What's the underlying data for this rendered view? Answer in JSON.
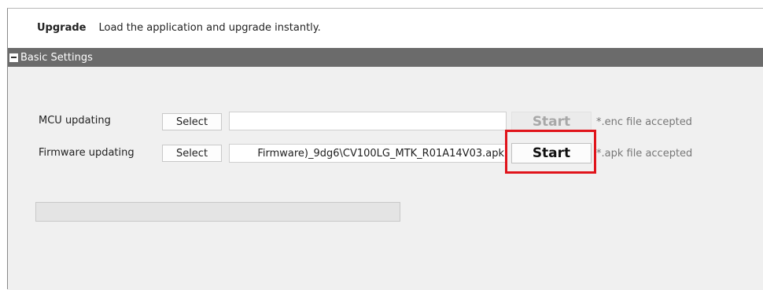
{
  "header": {
    "title": "Upgrade",
    "description": "Load the application and upgrade instantly."
  },
  "section": {
    "label": "Basic Settings"
  },
  "mcu": {
    "label": "MCU updating",
    "select_label": "Select",
    "path": "",
    "start_label": "Start",
    "hint": "*.enc file accepted"
  },
  "firmware": {
    "label": "Firmware updating",
    "select_label": "Select",
    "path": "Firmware)_9dg6\\CV100LG_MTK_R01A14V03.apk",
    "start_label": "Start",
    "hint": "*.apk file accepted"
  },
  "progress": {
    "value": 0
  },
  "colors": {
    "highlight": "#e0141b",
    "section_bar": "#6b6b6b",
    "panel": "#f0f0f0"
  }
}
